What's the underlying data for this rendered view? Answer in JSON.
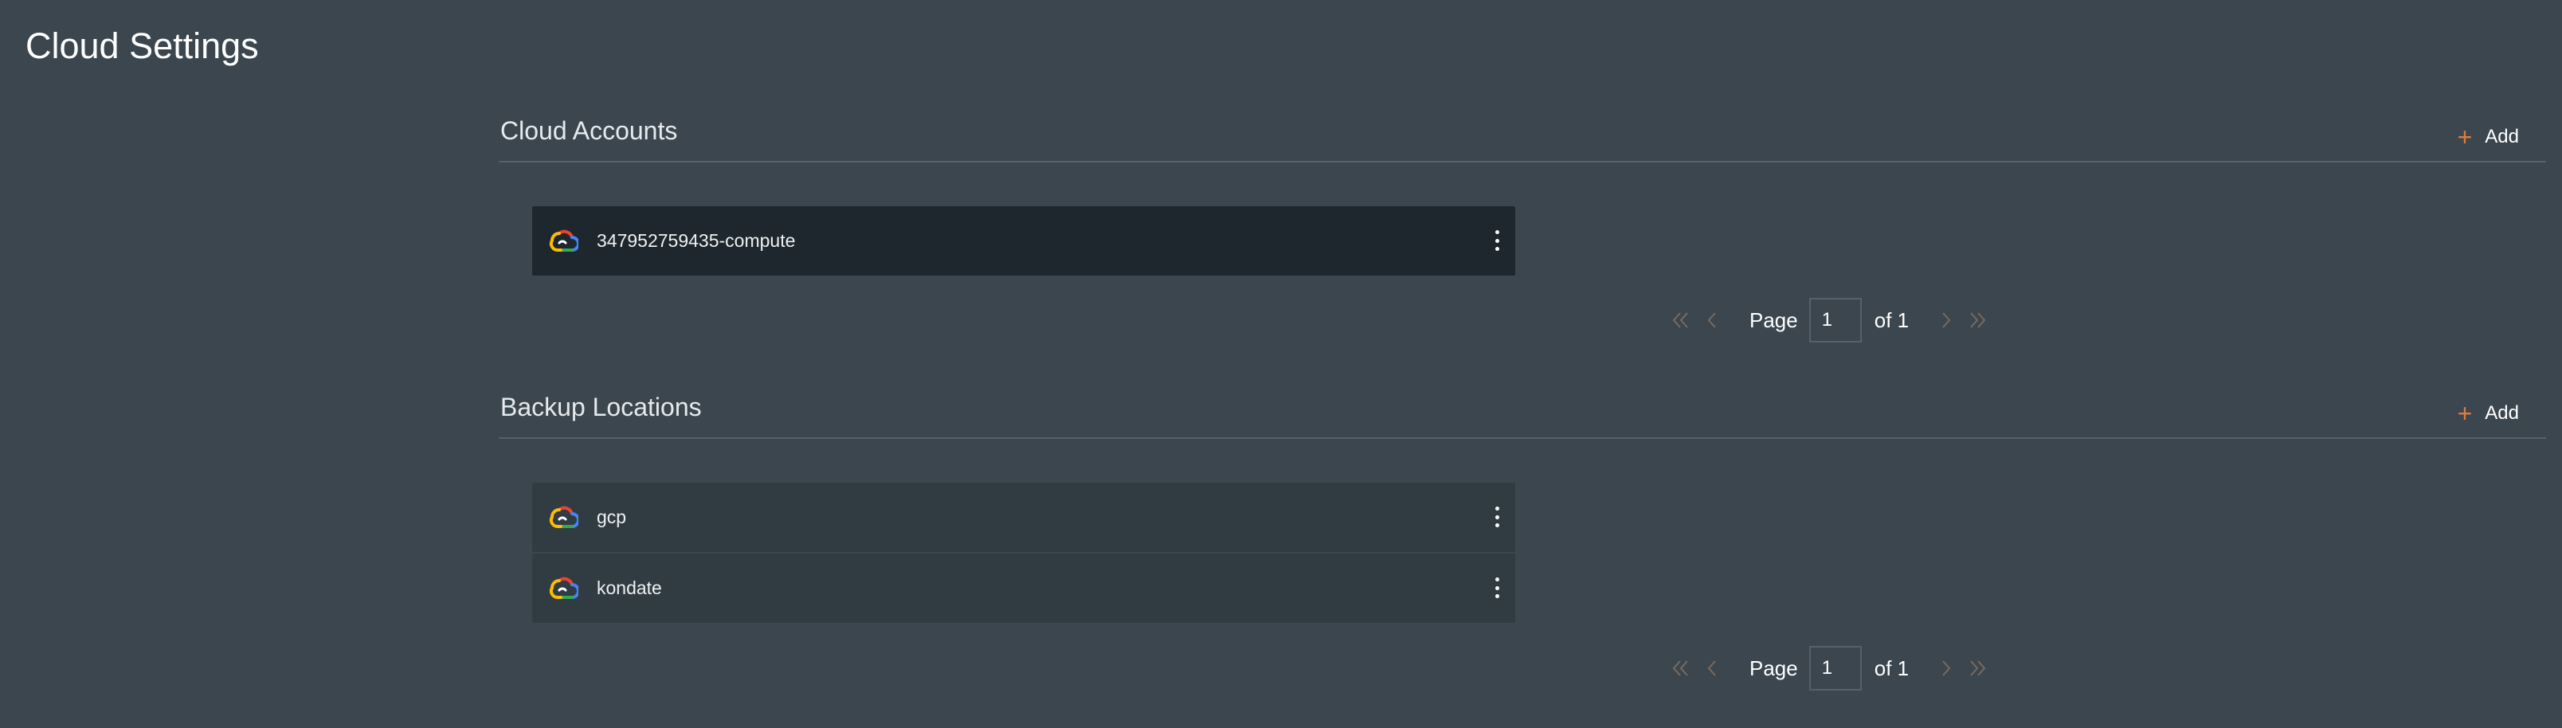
{
  "page": {
    "title": "Cloud Settings"
  },
  "cloud_accounts": {
    "title": "Cloud Accounts",
    "add_label": "Add",
    "items": [
      {
        "name": "347952759435-compute",
        "icon": "google-cloud-icon"
      }
    ],
    "pagination": {
      "page_label": "Page",
      "current_page": "1",
      "of_label": "of 1"
    }
  },
  "backup_locations": {
    "title": "Backup Locations",
    "add_label": "Add",
    "items": [
      {
        "name": "gcp",
        "icon": "google-cloud-icon"
      },
      {
        "name": "kondate",
        "icon": "google-cloud-icon"
      }
    ],
    "pagination": {
      "page_label": "Page",
      "current_page": "1",
      "of_label": "of 1"
    }
  },
  "colors": {
    "background": "#3b464e",
    "row_dark": "#1e272d",
    "row_mid": "#313b42",
    "accent": "#e07a3d",
    "divider": "#56626a"
  }
}
